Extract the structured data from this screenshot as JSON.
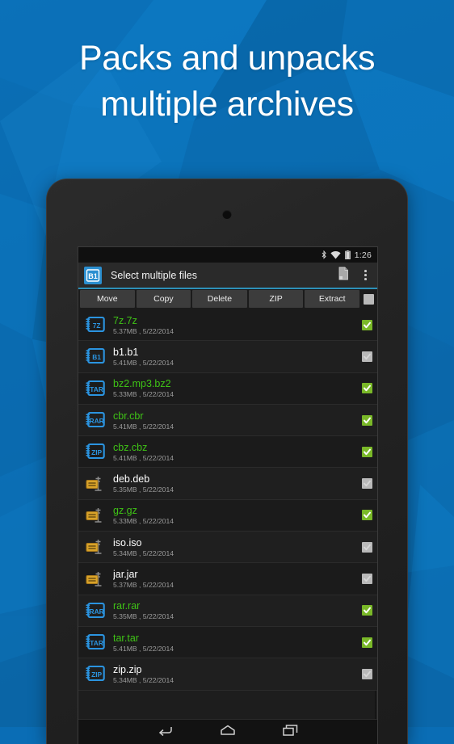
{
  "promo": {
    "headline_line1": "Packs and unpacks",
    "headline_line2": "multiple archives"
  },
  "statusbar": {
    "bluetooth_icon": "bluetooth-icon",
    "wifi_icon": "wifi-icon",
    "battery_icon": "battery-icon",
    "clock": "1:26"
  },
  "appbar": {
    "logo_text": "B1",
    "title": "Select multiple files",
    "paste_icon": "paste-document-icon",
    "overflow_icon": "overflow-menu-icon"
  },
  "toolbar": {
    "buttons": [
      {
        "label": "Move",
        "name": "move-button"
      },
      {
        "label": "Copy",
        "name": "copy-button"
      },
      {
        "label": "Delete",
        "name": "delete-button"
      },
      {
        "label": "ZIP",
        "name": "zip-button"
      },
      {
        "label": "Extract",
        "name": "extract-button"
      }
    ],
    "select_all_checked": false
  },
  "files": [
    {
      "name": "7z.7z",
      "details": "5.37MB , 5/22/2014",
      "icon_label": "7Z",
      "icon_type": "archive",
      "selected": true
    },
    {
      "name": "b1.b1",
      "details": "5.41MB , 5/22/2014",
      "icon_label": "B1",
      "icon_type": "archive",
      "selected": false
    },
    {
      "name": "bz2.mp3.bz2",
      "details": "5.33MB , 5/22/2014",
      "icon_label": "TAR",
      "icon_type": "archive",
      "selected": true
    },
    {
      "name": "cbr.cbr",
      "details": "5.41MB , 5/22/2014",
      "icon_label": "RAR",
      "icon_type": "archive",
      "selected": true
    },
    {
      "name": "cbz.cbz",
      "details": "5.41MB , 5/22/2014",
      "icon_label": "ZIP",
      "icon_type": "archive",
      "selected": true
    },
    {
      "name": "deb.deb",
      "details": "5.35MB , 5/22/2014",
      "icon_label": "",
      "icon_type": "generic",
      "selected": false
    },
    {
      "name": "gz.gz",
      "details": "5.33MB , 5/22/2014",
      "icon_label": "",
      "icon_type": "generic",
      "selected": true
    },
    {
      "name": "iso.iso",
      "details": "5.34MB , 5/22/2014",
      "icon_label": "",
      "icon_type": "generic",
      "selected": false
    },
    {
      "name": "jar.jar",
      "details": "5.37MB , 5/22/2014",
      "icon_label": "",
      "icon_type": "generic",
      "selected": false
    },
    {
      "name": "rar.rar",
      "details": "5.35MB , 5/22/2014",
      "icon_label": "RAR",
      "icon_type": "archive",
      "selected": true
    },
    {
      "name": "tar.tar",
      "details": "5.41MB , 5/22/2014",
      "icon_label": "TAR",
      "icon_type": "archive",
      "selected": true
    },
    {
      "name": "zip.zip",
      "details": "5.34MB , 5/22/2014",
      "icon_label": "ZIP",
      "icon_type": "archive",
      "selected": false
    }
  ],
  "navbar": {
    "back_icon": "back-arrow-icon",
    "home_icon": "home-icon",
    "recents_icon": "recent-apps-icon"
  },
  "colors": {
    "promo_background": "#0a6db5",
    "accent_line": "#2d90b8",
    "selected_filename": "#3fc316",
    "checkbox_checked": "#7ab828",
    "checkbox_unchecked": "#b9b9b9",
    "archive_icon": "#2b94e0",
    "generic_icon": "#d9a32a",
    "logo_background": "#2b8fd0"
  }
}
